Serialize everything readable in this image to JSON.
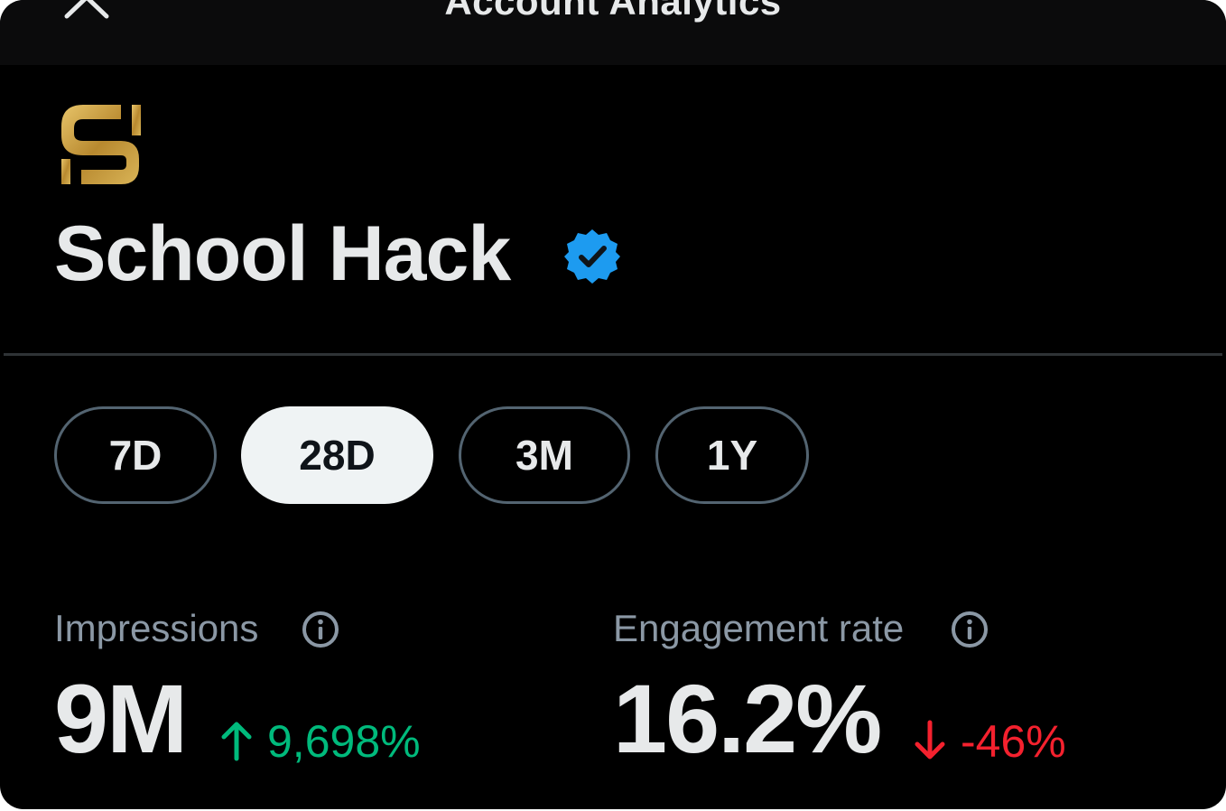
{
  "header": {
    "title": "Account Analytics",
    "close_icon": "close-icon"
  },
  "account": {
    "name": "School Hack",
    "verified": true,
    "logo_icon": "school-hack-logo",
    "verified_icon": "verified-badge-icon"
  },
  "periods": {
    "tabs": [
      {
        "label": "7D",
        "active": false
      },
      {
        "label": "28D",
        "active": true
      },
      {
        "label": "3M",
        "active": false
      },
      {
        "label": "1Y",
        "active": false
      }
    ],
    "selected": "28D"
  },
  "metrics": [
    {
      "label": "Impressions",
      "value": "9M",
      "change": "9,698%",
      "direction": "up",
      "info_icon": "info-icon"
    },
    {
      "label": "Engagement rate",
      "value": "16.2%",
      "change": "-46%",
      "direction": "down",
      "info_icon": "info-icon"
    }
  ],
  "colors": {
    "background": "#000000",
    "text_primary": "#e7e9ea",
    "text_secondary": "#8b98a5",
    "positive": "#00ba7c",
    "negative": "#f4212e",
    "verified": "#1d9bf0",
    "logo_gold": "#c9a44c",
    "tab_active_bg": "#eff3f4",
    "tab_border": "#536471"
  }
}
